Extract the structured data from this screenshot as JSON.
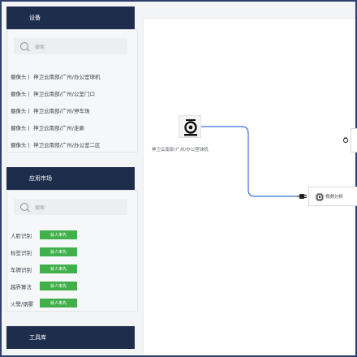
{
  "sidebar": {
    "devices": {
      "title": "设备",
      "search_placeholder": "搜索",
      "items": [
        {
          "label": "摄像头丨 神卫云南部/广州/办公室球机"
        },
        {
          "label": "摄像头丨 神卫云南部/广州/公室门口"
        },
        {
          "label": "摄像头丨 神卫云南部/广州/停车场"
        },
        {
          "label": "摄像头丨 神卫云南部/广州/走廊"
        },
        {
          "label": "摄像头丨 神卫云南部/广州/办公室二区"
        }
      ]
    },
    "apps": {
      "title": "应用市场",
      "search_placeholder": "搜索",
      "items": [
        {
          "label": "人脸识别",
          "badge": "就人率先"
        },
        {
          "label": "标签识别",
          "badge": "就人率先"
        },
        {
          "label": "车牌识别",
          "badge": "就人率先"
        },
        {
          "label": "越界算法",
          "badge": "就人率先"
        },
        {
          "label": "火警/烟雾",
          "badge": "就人率先"
        }
      ]
    },
    "tools": {
      "title": "工具库"
    }
  },
  "canvas": {
    "camera_node_label": "神卫云南部/广州/办公室球机",
    "analysis_node_label": "视频分析",
    "edge_color": "#3b6fd6"
  },
  "icons": {
    "camera": "camera-icon",
    "chip": "chip-icon",
    "plug": "plug-icon"
  }
}
